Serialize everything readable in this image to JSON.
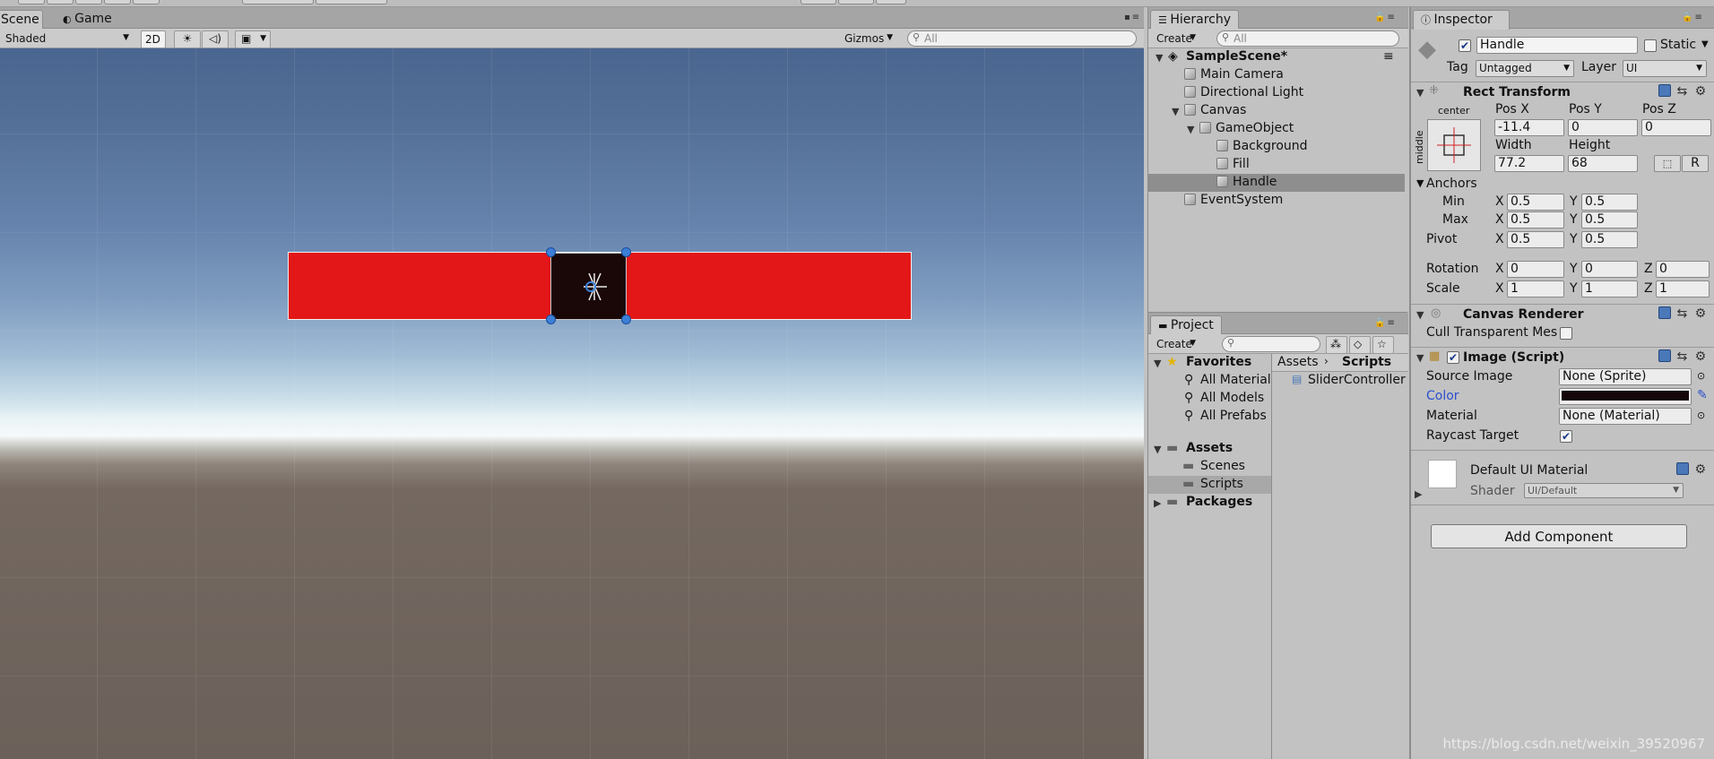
{
  "scene_view": {
    "tabs": [
      {
        "label": "Scene"
      },
      {
        "label": "Game"
      }
    ],
    "shading_mode": "Shaded",
    "mode_2d": "2D",
    "gizmos_label": "Gizmos",
    "search_placeholder": "All",
    "slider_background_color": "#e31717",
    "handle_color": "#1a0707"
  },
  "hierarchy": {
    "tab": "Hierarchy",
    "create_label": "Create",
    "search_placeholder": "All",
    "scene_name": "SampleScene*",
    "items": [
      {
        "label": "Main Camera"
      },
      {
        "label": "Directional Light"
      },
      {
        "label": "Canvas"
      },
      {
        "label": "GameObject"
      },
      {
        "label": "Background"
      },
      {
        "label": "Fill"
      },
      {
        "label": "Handle"
      },
      {
        "label": "EventSystem"
      }
    ]
  },
  "project": {
    "tab": "Project",
    "create_label": "Create",
    "favorites_label": "Favorites",
    "favorites": [
      {
        "label": "All Materials"
      },
      {
        "label": "All Models"
      },
      {
        "label": "All Prefabs"
      }
    ],
    "assets_label": "Assets",
    "asset_folders": [
      {
        "label": "Scenes"
      },
      {
        "label": "Scripts"
      }
    ],
    "packages_label": "Packages",
    "breadcrumb": [
      "Assets",
      "Scripts"
    ],
    "files": [
      {
        "label": "SliderController"
      }
    ]
  },
  "inspector": {
    "tab": "Inspector",
    "object_name": "Handle",
    "static_label": "Static",
    "tag_label": "Tag",
    "tag_value": "Untagged",
    "layer_label": "Layer",
    "layer_value": "UI",
    "rect_transform": {
      "title": "Rect Transform",
      "anchor_h": "center",
      "anchor_v": "middle",
      "pos_x_label": "Pos X",
      "pos_x": "-11.4",
      "pos_y_label": "Pos Y",
      "pos_y": "0",
      "pos_z_label": "Pos Z",
      "pos_z": "0",
      "width_label": "Width",
      "width": "77.2",
      "height_label": "Height",
      "height": "68",
      "r_button": "R",
      "anchors_label": "Anchors",
      "min_label": "Min",
      "min_x": "0.5",
      "min_y": "0.5",
      "max_label": "Max",
      "max_x": "0.5",
      "max_y": "0.5",
      "pivot_label": "Pivot",
      "pivot_x": "0.5",
      "pivot_y": "0.5",
      "rotation_label": "Rotation",
      "rot_x": "0",
      "rot_y": "0",
      "rot_z": "0",
      "scale_label": "Scale",
      "scale_x": "1",
      "scale_y": "1",
      "scale_z": "1",
      "x": "X",
      "y": "Y",
      "z": "Z"
    },
    "canvas_renderer": {
      "title": "Canvas Renderer",
      "cull_label": "Cull Transparent Mes"
    },
    "image_script": {
      "title": "Image (Script)",
      "source_image_label": "Source Image",
      "source_image": "None (Sprite)",
      "color_label": "Color",
      "color": "#15060a",
      "material_label": "Material",
      "material": "None (Material)",
      "raycast_label": "Raycast Target"
    },
    "material_preview": {
      "name": "Default UI Material",
      "shader_label": "Shader",
      "shader_value": "UI/Default"
    },
    "add_component": "Add Component"
  },
  "watermark": "https://blog.csdn.net/weixin_39520967"
}
